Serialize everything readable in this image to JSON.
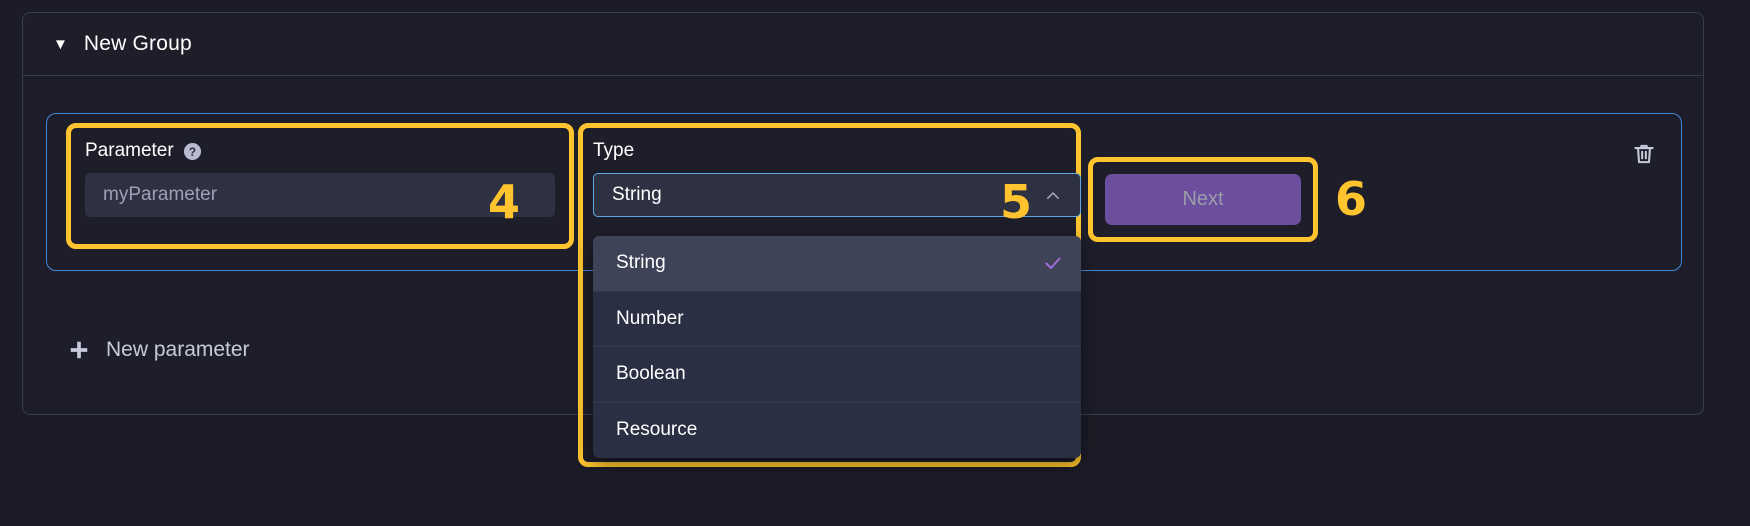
{
  "group": {
    "caret": "▼",
    "title": "New Group"
  },
  "parameter_row": {
    "parameter": {
      "label": "Parameter",
      "help_icon": "question-circle-icon",
      "value": "",
      "placeholder": "myParameter"
    },
    "type": {
      "label": "Type",
      "selected": "String",
      "chevron": "chevron-up-icon",
      "options": [
        {
          "label": "String",
          "selected": true
        },
        {
          "label": "Number",
          "selected": false
        },
        {
          "label": "Boolean",
          "selected": false
        },
        {
          "label": "Resource",
          "selected": false
        }
      ]
    },
    "next_button": {
      "label": "Next",
      "disabled": true
    },
    "delete_icon": "trash-icon"
  },
  "new_parameter": {
    "icon": "plus-icon",
    "label": "New parameter"
  },
  "annotations": [
    {
      "number": "4",
      "target": "parameter-field"
    },
    {
      "number": "5",
      "target": "type-select"
    },
    {
      "number": "6",
      "target": "next-button"
    }
  ],
  "colors": {
    "annotation": "#ffc42e",
    "focus_border": "#5fa8e8",
    "row_border": "#3f87d8",
    "accent_check": "#a46fe0",
    "button": "#6b4f9e",
    "panel_bg": "#1e1e2a",
    "page_bg": "#1c1c28"
  }
}
